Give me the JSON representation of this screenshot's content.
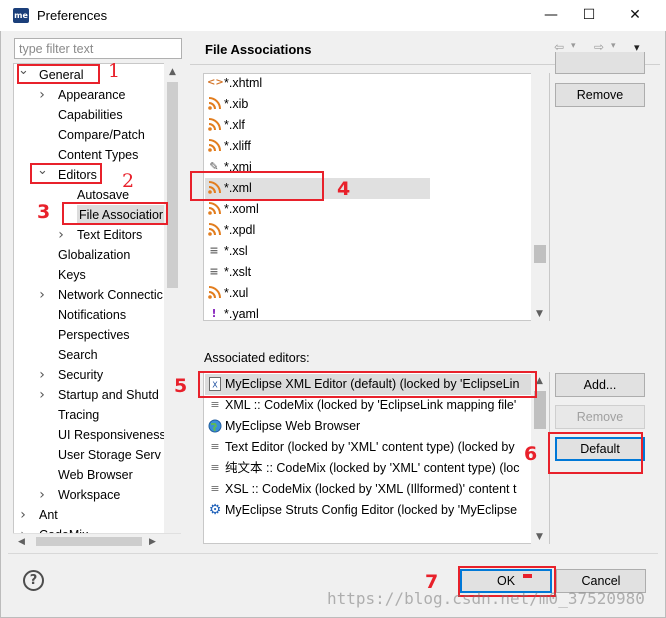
{
  "window": {
    "title": "Preferences",
    "logo_text": "me",
    "controls": {
      "minimize": "—",
      "maximize": "☐",
      "close": "✕"
    }
  },
  "filter": {
    "placeholder": "type filter text"
  },
  "tree": {
    "items": [
      {
        "label": "General",
        "chevron": "down",
        "selected": false
      },
      {
        "label": "Appearance",
        "chevron": "right"
      },
      {
        "label": "Capabilities",
        "chevron": ""
      },
      {
        "label": "Compare/Patch",
        "chevron": ""
      },
      {
        "label": "Content Types",
        "chevron": ""
      },
      {
        "label": "Editors",
        "chevron": "down"
      },
      {
        "label": "Autosave",
        "chevron": ""
      },
      {
        "label": "File Associatior",
        "chevron": "",
        "selected": true
      },
      {
        "label": "Text Editors",
        "chevron": "right"
      },
      {
        "label": "Globalization",
        "chevron": ""
      },
      {
        "label": "Keys",
        "chevron": ""
      },
      {
        "label": "Network Connectic",
        "chevron": "right"
      },
      {
        "label": "Notifications",
        "chevron": ""
      },
      {
        "label": "Perspectives",
        "chevron": ""
      },
      {
        "label": "Search",
        "chevron": ""
      },
      {
        "label": "Security",
        "chevron": "right"
      },
      {
        "label": "Startup and Shutd",
        "chevron": "right"
      },
      {
        "label": "Tracing",
        "chevron": ""
      },
      {
        "label": "UI Responsiveness",
        "chevron": ""
      },
      {
        "label": "User Storage Serv",
        "chevron": ""
      },
      {
        "label": "Web Browser",
        "chevron": ""
      },
      {
        "label": "Workspace",
        "chevron": "right"
      },
      {
        "label": "Ant",
        "chevron": "right"
      },
      {
        "label": "CodeMix",
        "chevron": "right"
      }
    ]
  },
  "right_pane": {
    "title": "File Associations",
    "nav": {
      "back": "⇦",
      "back_menu": "▾",
      "forward": "⇨",
      "forward_menu": "▾",
      "view_menu": "▾"
    },
    "file_types": [
      {
        "label": "*.xhtml",
        "icon": "code"
      },
      {
        "label": "*.xib",
        "icon": "rss"
      },
      {
        "label": "*.xlf",
        "icon": "rss"
      },
      {
        "label": "*.xliff",
        "icon": "rss"
      },
      {
        "label": "*.xmi",
        "icon": "xmi"
      },
      {
        "label": "*.xml",
        "icon": "rss",
        "selected": true
      },
      {
        "label": "*.xoml",
        "icon": "rss"
      },
      {
        "label": "*.xpdl",
        "icon": "rss"
      },
      {
        "label": "*.xsl",
        "icon": "text"
      },
      {
        "label": "*.xslt",
        "icon": "text"
      },
      {
        "label": "*.xul",
        "icon": "rss"
      },
      {
        "label": "*.yaml",
        "icon": "exclaim"
      }
    ],
    "file_buttons": {
      "remove": "Remove"
    },
    "associated_label": "Associated editors:",
    "editors": [
      {
        "label": "MyEclipse XML Editor (default) (locked by 'EclipseLin",
        "icon": "xml",
        "selected": true
      },
      {
        "label": "XML :: CodeMix (locked by 'EclipseLink mapping file'",
        "icon": "text"
      },
      {
        "label": "MyEclipse Web Browser",
        "icon": "globe"
      },
      {
        "label": "Text Editor (locked by 'XML' content type) (locked by",
        "icon": "text"
      },
      {
        "label": "纯文本 :: CodeMix (locked by 'XML' content type) (loc",
        "icon": "text"
      },
      {
        "label": "XSL :: CodeMix (locked by 'XML (Illformed)' content t",
        "icon": "text"
      },
      {
        "label": "MyEclipse Struts Config Editor (locked by 'MyEclipse",
        "icon": "gear"
      }
    ],
    "editor_buttons": {
      "add": "Add...",
      "remove": "Remove",
      "default": "Default"
    }
  },
  "footer": {
    "help": "?",
    "ok": "OK",
    "cancel": "Cancel"
  },
  "annotations": [
    "1",
    "2",
    "3",
    "4",
    "5",
    "6",
    "7"
  ],
  "watermark": "https://blog.csdn.net/m0_37520980",
  "colors": {
    "annotation": "#e8212b",
    "rss_icon": "#e27d1e",
    "default_focus": "#0078d7"
  }
}
